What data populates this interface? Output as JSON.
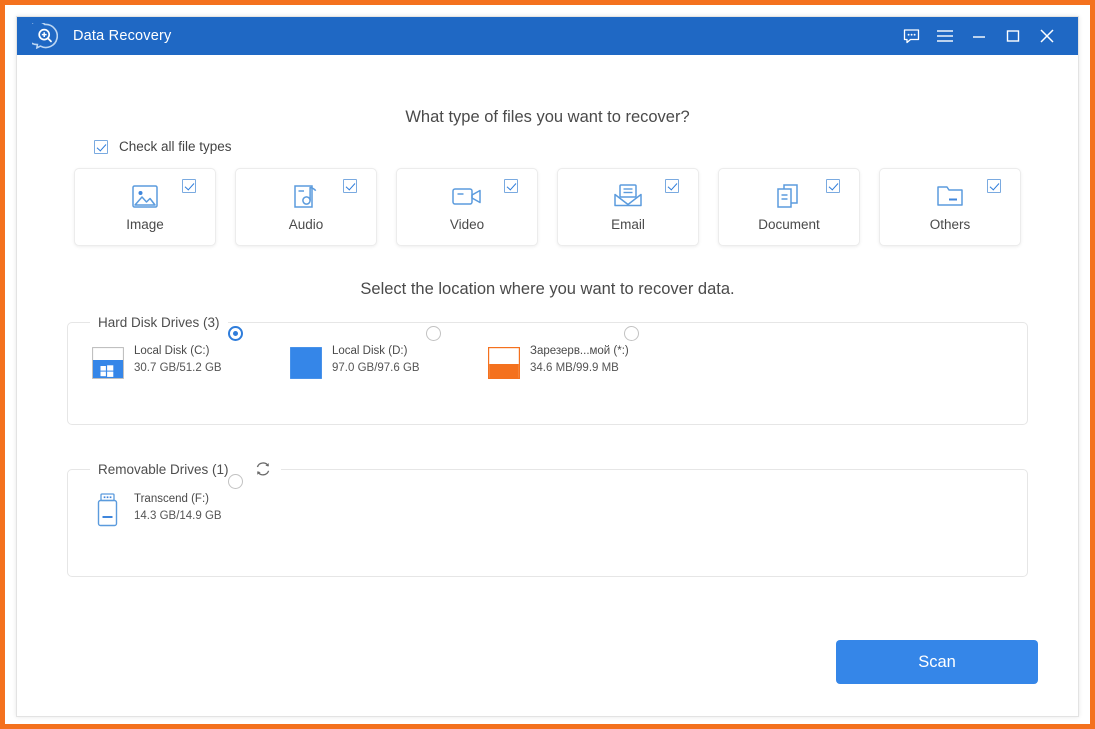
{
  "window": {
    "title": "Data Recovery",
    "logo_icon": "magnifier-bubble-logo",
    "accent_color": "#1f68c4",
    "frame_color": "#f4711e",
    "controls": [
      {
        "name": "feedback-button",
        "icon": "chat-bubble-icon"
      },
      {
        "name": "menu-button",
        "icon": "hamburger-menu-icon"
      },
      {
        "name": "minimize-button",
        "icon": "minimize-icon"
      },
      {
        "name": "maximize-button",
        "icon": "maximize-icon"
      },
      {
        "name": "close-button",
        "icon": "close-icon"
      }
    ]
  },
  "headings": {
    "file_types": "What type of files you want to recover?",
    "location": "Select the location where you want to recover data."
  },
  "check_all": {
    "label": "Check all file types",
    "checked": true
  },
  "file_types": [
    {
      "label": "Image",
      "icon": "image-icon",
      "checked": true
    },
    {
      "label": "Audio",
      "icon": "audio-icon",
      "checked": true
    },
    {
      "label": "Video",
      "icon": "video-icon",
      "checked": true
    },
    {
      "label": "Email",
      "icon": "email-icon",
      "checked": true
    },
    {
      "label": "Document",
      "icon": "document-icon",
      "checked": true
    },
    {
      "label": "Others",
      "icon": "folder-icon",
      "checked": true
    }
  ],
  "hard_disk_drives": {
    "legend": "Hard Disk Drives (3)",
    "drives": [
      {
        "name": "Local Disk (C:)",
        "capacity": "30.7 GB/51.2 GB",
        "icon": "hard-drive-windows-icon",
        "fill_percent": 60,
        "fill_color": "#3586e8",
        "selected": true
      },
      {
        "name": "Local Disk (D:)",
        "capacity": "97.0 GB/97.6 GB",
        "icon": "hard-drive-icon",
        "fill_percent": 100,
        "fill_color": "#3586e8",
        "selected": false
      },
      {
        "name": "Зарезерв...мой (*:)",
        "capacity": "34.6 MB/99.9 MB",
        "icon": "hard-drive-icon",
        "fill_percent": 52,
        "fill_color": "#f4711e",
        "selected": false
      }
    ]
  },
  "removable_drives": {
    "legend": "Removable Drives (1)",
    "refresh_icon": "refresh-icon",
    "drives": [
      {
        "name": "Transcend (F:)",
        "capacity": "14.3 GB/14.9 GB",
        "icon": "usb-flash-drive-icon",
        "selected": false
      }
    ]
  },
  "scan_button": {
    "label": "Scan",
    "color": "#3586e8"
  }
}
